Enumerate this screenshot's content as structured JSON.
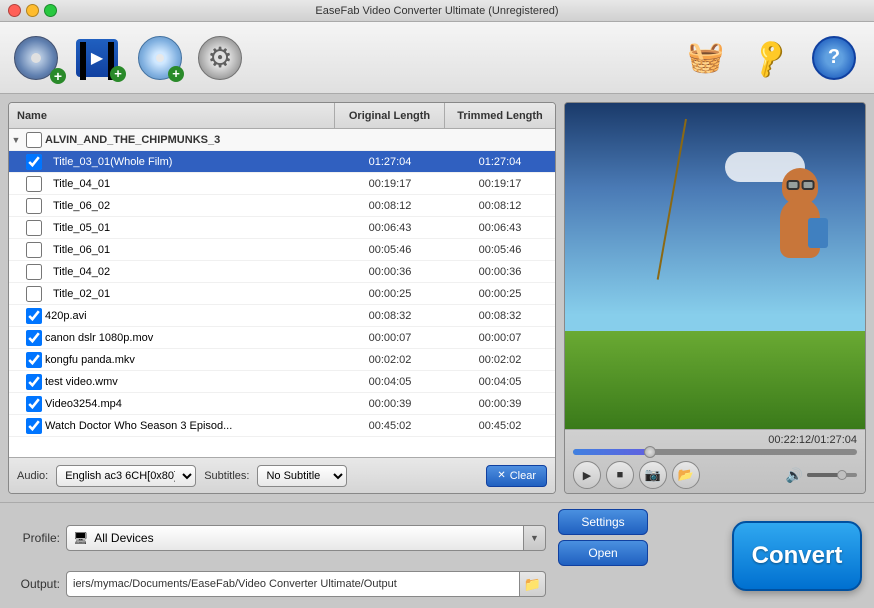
{
  "window": {
    "title": "EaseFab Video Converter Ultimate (Unregistered)"
  },
  "toolbar": {
    "icons": [
      {
        "name": "dvd-add-icon",
        "label": "Add DVD"
      },
      {
        "name": "video-add-icon",
        "label": "Add Video"
      },
      {
        "name": "disc-add-icon",
        "label": "Add Disc"
      },
      {
        "name": "settings-icon",
        "label": "Settings"
      }
    ],
    "right_icons": [
      {
        "name": "basket-icon",
        "label": "🧺"
      },
      {
        "name": "key-icon",
        "label": "🔑"
      },
      {
        "name": "help-icon",
        "label": "?"
      }
    ]
  },
  "file_list": {
    "col_name": "Name",
    "col_original": "Original Length",
    "col_trimmed": "Trimmed Length",
    "folder": "ALVIN_AND_THE_CHIPMUNKS_3",
    "rows": [
      {
        "name": "Title_03_01(Whole Film)",
        "original": "01:27:04",
        "trimmed": "01:27:04",
        "checked": true,
        "indent": true,
        "selected": true
      },
      {
        "name": "Title_04_01",
        "original": "00:19:17",
        "trimmed": "00:19:17",
        "checked": false,
        "indent": true,
        "selected": false
      },
      {
        "name": "Title_06_02",
        "original": "00:08:12",
        "trimmed": "00:08:12",
        "checked": false,
        "indent": true,
        "selected": false
      },
      {
        "name": "Title_05_01",
        "original": "00:06:43",
        "trimmed": "00:06:43",
        "checked": false,
        "indent": true,
        "selected": false
      },
      {
        "name": "Title_06_01",
        "original": "00:05:46",
        "trimmed": "00:05:46",
        "checked": false,
        "indent": true,
        "selected": false
      },
      {
        "name": "Title_04_02",
        "original": "00:00:36",
        "trimmed": "00:00:36",
        "checked": false,
        "indent": true,
        "selected": false
      },
      {
        "name": "Title_02_01",
        "original": "00:00:25",
        "trimmed": "00:00:25",
        "checked": false,
        "indent": true,
        "selected": false
      },
      {
        "name": "420p.avi",
        "original": "00:08:32",
        "trimmed": "00:08:32",
        "checked": true,
        "indent": false,
        "selected": false
      },
      {
        "name": "canon dslr 1080p.mov",
        "original": "00:00:07",
        "trimmed": "00:00:07",
        "checked": true,
        "indent": false,
        "selected": false
      },
      {
        "name": "kongfu panda.mkv",
        "original": "00:02:02",
        "trimmed": "00:02:02",
        "checked": true,
        "indent": false,
        "selected": false
      },
      {
        "name": "test video.wmv",
        "original": "00:04:05",
        "trimmed": "00:04:05",
        "checked": true,
        "indent": false,
        "selected": false
      },
      {
        "name": "Video3254.mp4",
        "original": "00:00:39",
        "trimmed": "00:00:39",
        "checked": true,
        "indent": false,
        "selected": false
      },
      {
        "name": "Watch Doctor Who Season 3 Episod...",
        "original": "00:45:02",
        "trimmed": "00:45:02",
        "checked": true,
        "indent": false,
        "selected": false
      }
    ]
  },
  "bottom_controls": {
    "audio_label": "Audio:",
    "audio_value": "English ac3 6CH[0x80]",
    "subtitles_label": "Subtitles:",
    "subtitles_value": "No Subtitle",
    "clear_label": "Clear"
  },
  "video": {
    "time_display": "00:22:12/01:27:04",
    "progress_percent": 27
  },
  "profile": {
    "label": "Profile:",
    "icon": "🖥",
    "value": "All Devices"
  },
  "output": {
    "label": "Output:",
    "path": "iers/mymac/Documents/EaseFab/Video Converter Ultimate/Output"
  },
  "buttons": {
    "settings": "Settings",
    "open": "Open",
    "convert": "Convert"
  }
}
